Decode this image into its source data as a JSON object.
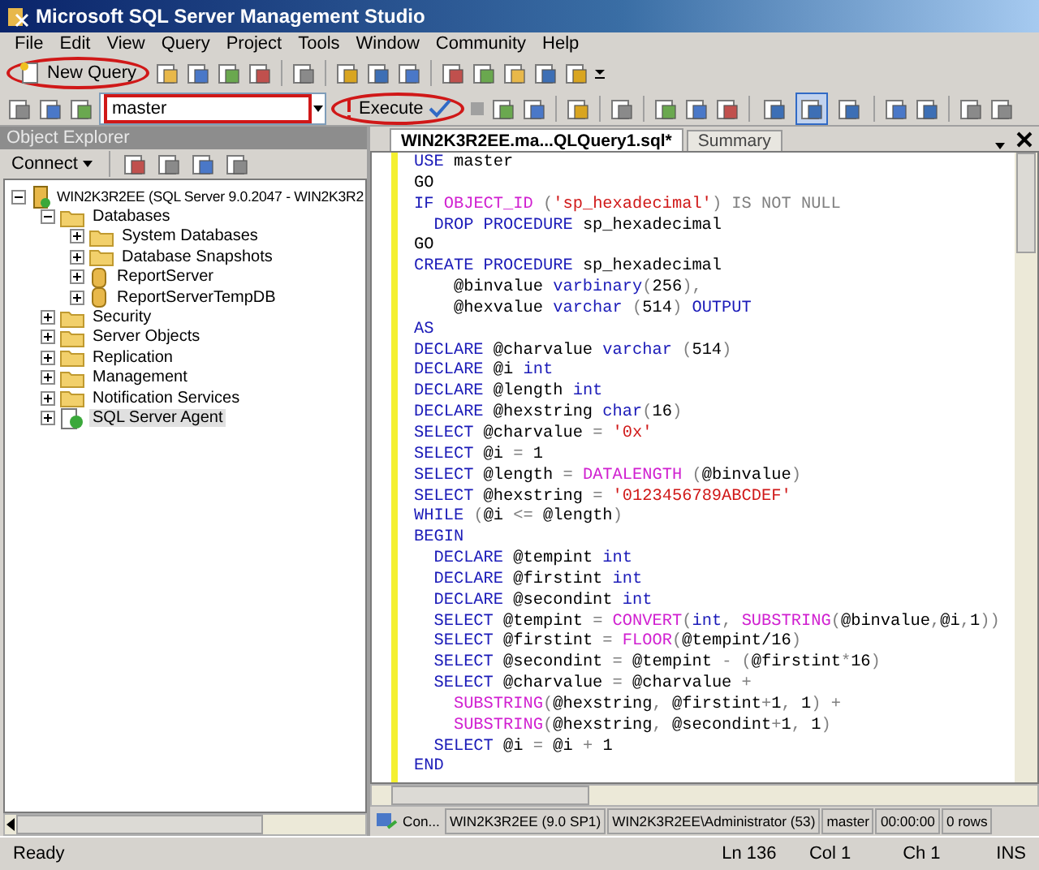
{
  "window": {
    "title": "Microsoft SQL Server Management Studio"
  },
  "menu": [
    "File",
    "Edit",
    "View",
    "Query",
    "Project",
    "Tools",
    "Window",
    "Community",
    "Help"
  ],
  "toolbar_1": {
    "new_query": {
      "label": "New Query",
      "highlighted": true
    }
  },
  "toolbar_2": {
    "database": {
      "value": "master",
      "highlighted": true
    },
    "execute": {
      "label": "Execute",
      "highlighted": true
    },
    "result_modes": [
      {
        "selected": false
      },
      {
        "selected": true
      },
      {
        "selected": false
      }
    ]
  },
  "object_explorer": {
    "title": "Object Explorer",
    "connect": "Connect",
    "tree": [
      {
        "label": "WIN2K3R2EE (SQL Server 9.0.2047 - WIN2K3R2",
        "kind": "server",
        "expanded": true,
        "selected": false,
        "children": [
          {
            "label": "Databases",
            "kind": "folder",
            "expanded": true,
            "selected": false,
            "children": [
              {
                "label": "System Databases",
                "kind": "folder",
                "expanded": false,
                "selected": false
              },
              {
                "label": "Database Snapshots",
                "kind": "folder",
                "expanded": false,
                "selected": false
              },
              {
                "label": "ReportServer",
                "kind": "database",
                "expanded": false,
                "selected": false
              },
              {
                "label": "ReportServerTempDB",
                "kind": "database",
                "expanded": false,
                "selected": false
              }
            ]
          },
          {
            "label": "Security",
            "kind": "folder",
            "expanded": false,
            "selected": false
          },
          {
            "label": "Server Objects",
            "kind": "folder",
            "expanded": false,
            "selected": false
          },
          {
            "label": "Replication",
            "kind": "folder",
            "expanded": false,
            "selected": false
          },
          {
            "label": "Management",
            "kind": "folder",
            "expanded": false,
            "selected": false
          },
          {
            "label": "Notification Services",
            "kind": "folder",
            "expanded": false,
            "selected": false
          },
          {
            "label": "SQL Server Agent",
            "kind": "agent",
            "expanded": false,
            "selected": true
          }
        ]
      }
    ]
  },
  "editor": {
    "tabs": [
      {
        "label": "WIN2K3R2EE.ma...QLQuery1.sql*",
        "selected": true
      },
      {
        "label": "Summary",
        "selected": false
      }
    ],
    "lines": [
      [
        {
          "kind": "keyword",
          "text": "USE"
        },
        {
          "kind": "plain",
          "text": " master"
        }
      ],
      [
        {
          "kind": "plain",
          "text": "GO"
        }
      ],
      [
        {
          "kind": "keyword",
          "text": "IF"
        },
        {
          "kind": "function",
          "text": " OBJECT_ID"
        },
        {
          "kind": "operator",
          "text": " ("
        },
        {
          "kind": "string",
          "text": "'sp_hexadecimal'"
        },
        {
          "kind": "operator",
          "text": ") IS NOT NULL"
        }
      ],
      [
        {
          "kind": "keyword",
          "text": "  DROP PROCEDURE"
        },
        {
          "kind": "plain",
          "text": " sp_hexadecimal"
        }
      ],
      [
        {
          "kind": "plain",
          "text": "GO"
        }
      ],
      [
        {
          "kind": "keyword",
          "text": "CREATE PROCEDURE"
        },
        {
          "kind": "plain",
          "text": " sp_hexadecimal"
        }
      ],
      [
        {
          "kind": "plain",
          "text": "    @binvalue "
        },
        {
          "kind": "keyword",
          "text": "varbinary"
        },
        {
          "kind": "operator",
          "text": "("
        },
        {
          "kind": "plain",
          "text": "256"
        },
        {
          "kind": "operator",
          "text": "),"
        }
      ],
      [
        {
          "kind": "plain",
          "text": "    @hexvalue "
        },
        {
          "kind": "keyword",
          "text": "varchar"
        },
        {
          "kind": "operator",
          "text": " ("
        },
        {
          "kind": "plain",
          "text": "514"
        },
        {
          "kind": "operator",
          "text": ")"
        },
        {
          "kind": "keyword",
          "text": " OUTPUT"
        }
      ],
      [
        {
          "kind": "keyword",
          "text": "AS"
        }
      ],
      [
        {
          "kind": "keyword",
          "text": "DECLARE"
        },
        {
          "kind": "plain",
          "text": " @charvalue "
        },
        {
          "kind": "keyword",
          "text": "varchar"
        },
        {
          "kind": "operator",
          "text": " ("
        },
        {
          "kind": "plain",
          "text": "514"
        },
        {
          "kind": "operator",
          "text": ")"
        }
      ],
      [
        {
          "kind": "keyword",
          "text": "DECLARE"
        },
        {
          "kind": "plain",
          "text": " @i "
        },
        {
          "kind": "keyword",
          "text": "int"
        }
      ],
      [
        {
          "kind": "keyword",
          "text": "DECLARE"
        },
        {
          "kind": "plain",
          "text": " @length "
        },
        {
          "kind": "keyword",
          "text": "int"
        }
      ],
      [
        {
          "kind": "keyword",
          "text": "DECLARE"
        },
        {
          "kind": "plain",
          "text": " @hexstring "
        },
        {
          "kind": "keyword",
          "text": "char"
        },
        {
          "kind": "operator",
          "text": "("
        },
        {
          "kind": "plain",
          "text": "16"
        },
        {
          "kind": "operator",
          "text": ")"
        }
      ],
      [
        {
          "kind": "keyword",
          "text": "SELECT"
        },
        {
          "kind": "plain",
          "text": " @charvalue "
        },
        {
          "kind": "operator",
          "text": "="
        },
        {
          "kind": "string",
          "text": " '0x'"
        }
      ],
      [
        {
          "kind": "keyword",
          "text": "SELECT"
        },
        {
          "kind": "plain",
          "text": " @i "
        },
        {
          "kind": "operator",
          "text": "="
        },
        {
          "kind": "plain",
          "text": " 1"
        }
      ],
      [
        {
          "kind": "keyword",
          "text": "SELECT"
        },
        {
          "kind": "plain",
          "text": " @length "
        },
        {
          "kind": "operator",
          "text": "="
        },
        {
          "kind": "function",
          "text": " DATALENGTH"
        },
        {
          "kind": "operator",
          "text": " ("
        },
        {
          "kind": "plain",
          "text": "@binvalue"
        },
        {
          "kind": "operator",
          "text": ")"
        }
      ],
      [
        {
          "kind": "keyword",
          "text": "SELECT"
        },
        {
          "kind": "plain",
          "text": " @hexstring "
        },
        {
          "kind": "operator",
          "text": "="
        },
        {
          "kind": "string",
          "text": " '0123456789ABCDEF'"
        }
      ],
      [
        {
          "kind": "keyword",
          "text": "WHILE"
        },
        {
          "kind": "operator",
          "text": " ("
        },
        {
          "kind": "plain",
          "text": "@i "
        },
        {
          "kind": "operator",
          "text": "<="
        },
        {
          "kind": "plain",
          "text": " @length"
        },
        {
          "kind": "operator",
          "text": ")"
        }
      ],
      [
        {
          "kind": "keyword",
          "text": "BEGIN"
        }
      ],
      [
        {
          "kind": "keyword",
          "text": "  DECLARE"
        },
        {
          "kind": "plain",
          "text": " @tempint "
        },
        {
          "kind": "keyword",
          "text": "int"
        }
      ],
      [
        {
          "kind": "keyword",
          "text": "  DECLARE"
        },
        {
          "kind": "plain",
          "text": " @firstint "
        },
        {
          "kind": "keyword",
          "text": "int"
        }
      ],
      [
        {
          "kind": "keyword",
          "text": "  DECLARE"
        },
        {
          "kind": "plain",
          "text": " @secondint "
        },
        {
          "kind": "keyword",
          "text": "int"
        }
      ],
      [
        {
          "kind": "keyword",
          "text": "  SELECT"
        },
        {
          "kind": "plain",
          "text": " @tempint "
        },
        {
          "kind": "operator",
          "text": "="
        },
        {
          "kind": "function",
          "text": " CONVERT"
        },
        {
          "kind": "operator",
          "text": "("
        },
        {
          "kind": "keyword",
          "text": "int"
        },
        {
          "kind": "operator",
          "text": ","
        },
        {
          "kind": "function",
          "text": " SUBSTRING"
        },
        {
          "kind": "operator",
          "text": "("
        },
        {
          "kind": "plain",
          "text": "@binvalue"
        },
        {
          "kind": "operator",
          "text": ","
        },
        {
          "kind": "plain",
          "text": "@i"
        },
        {
          "kind": "operator",
          "text": ","
        },
        {
          "kind": "plain",
          "text": "1"
        },
        {
          "kind": "operator",
          "text": "))"
        }
      ],
      [
        {
          "kind": "keyword",
          "text": "  SELECT"
        },
        {
          "kind": "plain",
          "text": " @firstint "
        },
        {
          "kind": "operator",
          "text": "="
        },
        {
          "kind": "function",
          "text": " FLOOR"
        },
        {
          "kind": "operator",
          "text": "("
        },
        {
          "kind": "plain",
          "text": "@tempint/16"
        },
        {
          "kind": "operator",
          "text": ")"
        }
      ],
      [
        {
          "kind": "keyword",
          "text": "  SELECT"
        },
        {
          "kind": "plain",
          "text": " @secondint "
        },
        {
          "kind": "operator",
          "text": "="
        },
        {
          "kind": "plain",
          "text": " @tempint "
        },
        {
          "kind": "operator",
          "text": "- ("
        },
        {
          "kind": "plain",
          "text": "@firstint"
        },
        {
          "kind": "operator",
          "text": "*"
        },
        {
          "kind": "plain",
          "text": "16"
        },
        {
          "kind": "operator",
          "text": ")"
        }
      ],
      [
        {
          "kind": "keyword",
          "text": "  SELECT"
        },
        {
          "kind": "plain",
          "text": " @charvalue "
        },
        {
          "kind": "operator",
          "text": "="
        },
        {
          "kind": "plain",
          "text": " @charvalue "
        },
        {
          "kind": "operator",
          "text": "+"
        }
      ],
      [
        {
          "kind": "function",
          "text": "    SUBSTRING"
        },
        {
          "kind": "operator",
          "text": "("
        },
        {
          "kind": "plain",
          "text": "@hexstring"
        },
        {
          "kind": "operator",
          "text": ","
        },
        {
          "kind": "plain",
          "text": " @firstint"
        },
        {
          "kind": "operator",
          "text": "+"
        },
        {
          "kind": "plain",
          "text": "1"
        },
        {
          "kind": "operator",
          "text": ","
        },
        {
          "kind": "plain",
          "text": " 1"
        },
        {
          "kind": "operator",
          "text": ") +"
        }
      ],
      [
        {
          "kind": "function",
          "text": "    SUBSTRING"
        },
        {
          "kind": "operator",
          "text": "("
        },
        {
          "kind": "plain",
          "text": "@hexstring"
        },
        {
          "kind": "operator",
          "text": ","
        },
        {
          "kind": "plain",
          "text": " @secondint"
        },
        {
          "kind": "operator",
          "text": "+"
        },
        {
          "kind": "plain",
          "text": "1"
        },
        {
          "kind": "operator",
          "text": ","
        },
        {
          "kind": "plain",
          "text": " 1"
        },
        {
          "kind": "operator",
          "text": ")"
        }
      ],
      [
        {
          "kind": "keyword",
          "text": "  SELECT"
        },
        {
          "kind": "plain",
          "text": " @i "
        },
        {
          "kind": "operator",
          "text": "="
        },
        {
          "kind": "plain",
          "text": " @i "
        },
        {
          "kind": "operator",
          "text": "+"
        },
        {
          "kind": "plain",
          "text": " 1"
        }
      ],
      [
        {
          "kind": "keyword",
          "text": "END"
        }
      ]
    ]
  },
  "connection_bar": [
    "Con...",
    "WIN2K3R2EE (9.0 SP1)",
    "WIN2K3R2EE\\Administrator (53)",
    "master",
    "00:00:00",
    "0 rows"
  ],
  "status_bar": {
    "message": "Ready",
    "line": "Ln 136",
    "column": "Col 1",
    "char": "Ch 1",
    "mode": "INS"
  }
}
